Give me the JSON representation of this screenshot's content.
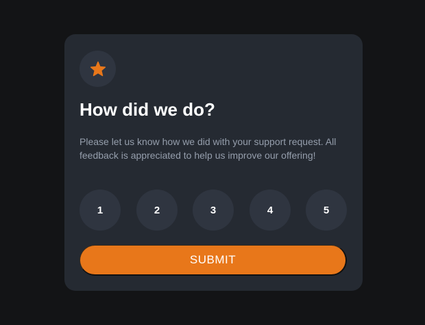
{
  "card": {
    "title": "How did we do?",
    "description": "Please let us know how we did with your support request. All feedback is appreciated to help us improve our offering!",
    "icon": "star-icon",
    "ratings": [
      "1",
      "2",
      "3",
      "4",
      "5"
    ],
    "submit_label": "SUBMIT"
  },
  "colors": {
    "background": "#131416",
    "card": "#252A32",
    "circle": "#2F3540",
    "accent": "#E8771A",
    "muted_text": "#959EAC"
  }
}
